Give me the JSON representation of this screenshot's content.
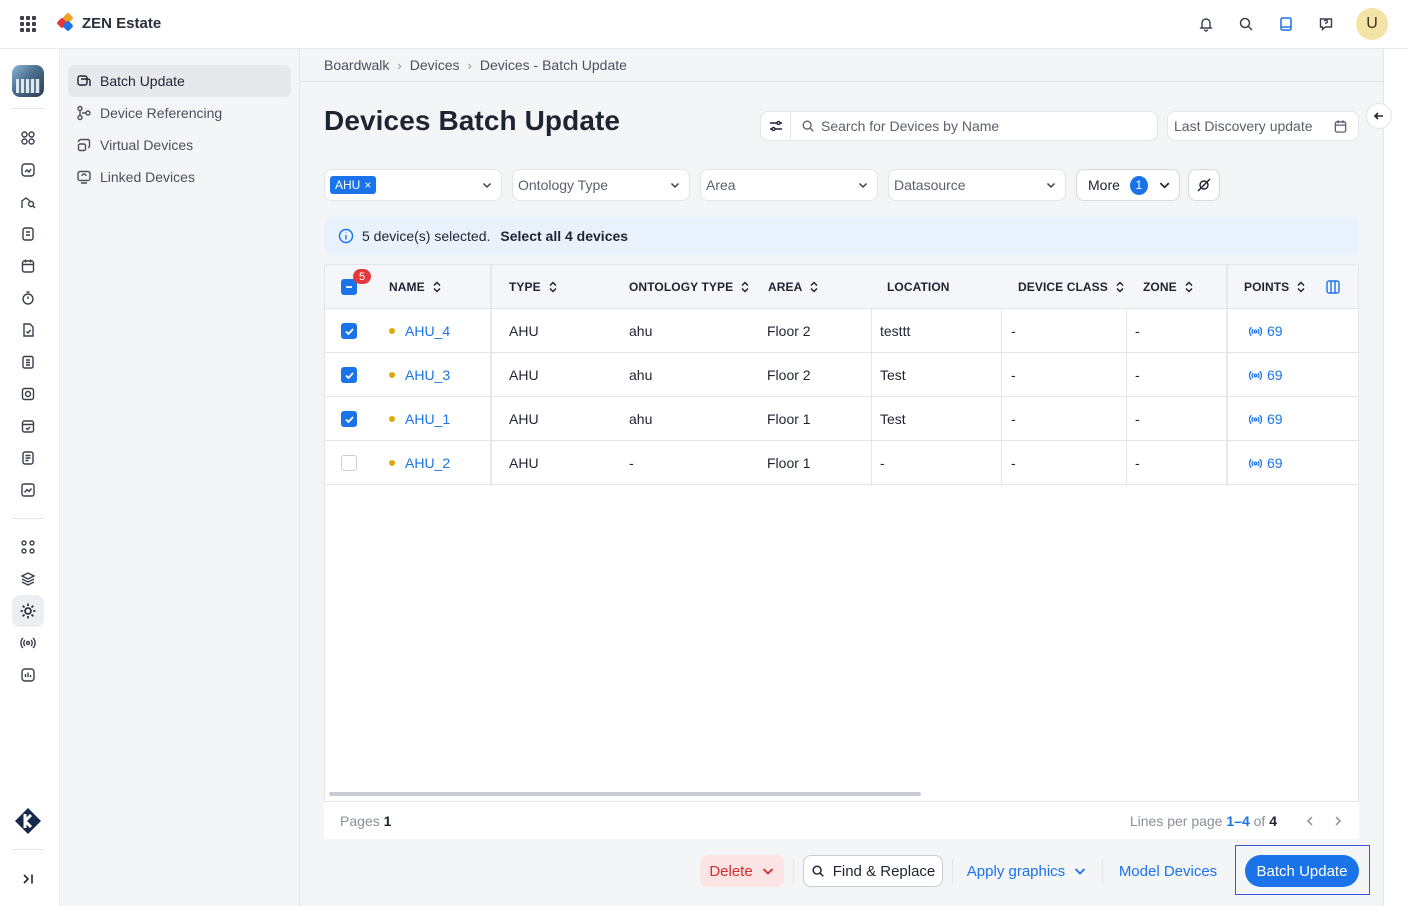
{
  "app": {
    "title": "ZEN Estate",
    "avatar_letter": "U"
  },
  "subnav": {
    "items": [
      {
        "label": "Batch Update",
        "icon": "batch-update-icon",
        "active": true
      },
      {
        "label": "Device Referencing",
        "icon": "device-referencing-icon",
        "active": false
      },
      {
        "label": "Virtual Devices",
        "icon": "virtual-devices-icon",
        "active": false
      },
      {
        "label": "Linked Devices",
        "icon": "linked-devices-icon",
        "active": false
      }
    ]
  },
  "breadcrumb": [
    "Boardwalk",
    "Devices",
    "Devices - Batch Update"
  ],
  "page": {
    "title": "Devices Batch Update"
  },
  "search": {
    "placeholder": "Search for Devices by Name",
    "value": ""
  },
  "date_filter": {
    "label": "Last Discovery update"
  },
  "filters": {
    "type_chip": "AHU",
    "ontology_placeholder": "Ontology Type",
    "area_placeholder": "Area",
    "datasource_placeholder": "Datasource",
    "more_label": "More",
    "more_count": "1"
  },
  "selection": {
    "message": "5 device(s) selected.",
    "select_all": "Select all 4 devices",
    "badge": "5"
  },
  "table": {
    "headers": {
      "name": "NAME",
      "type": "TYPE",
      "ontology": "ONTOLOGY TYPE",
      "area": "AREA",
      "location": "LOCATION",
      "device_class": "DEVICE CLASS",
      "zone": "ZONE",
      "points": "POINTS"
    },
    "rows": [
      {
        "checked": true,
        "name": "AHU_4",
        "type": "AHU",
        "ontology": "ahu",
        "area": "Floor 2",
        "location": "testtt",
        "device_class": "-",
        "zone": "-",
        "points": "69"
      },
      {
        "checked": true,
        "name": "AHU_3",
        "type": "AHU",
        "ontology": "ahu",
        "area": "Floor 2",
        "location": "Test",
        "device_class": "-",
        "zone": "-",
        "points": "69"
      },
      {
        "checked": true,
        "name": "AHU_1",
        "type": "AHU",
        "ontology": "ahu",
        "area": "Floor 1",
        "location": "Test",
        "device_class": "-",
        "zone": "-",
        "points": "69"
      },
      {
        "checked": false,
        "name": "AHU_2",
        "type": "AHU",
        "ontology": "-",
        "area": "Floor 1",
        "location": "-",
        "device_class": "-",
        "zone": "-",
        "points": "69"
      }
    ]
  },
  "pager": {
    "pages_label": "Pages",
    "pages": "1",
    "lines_label": "Lines per page",
    "range": "1–4",
    "of_label": "of",
    "total": "4"
  },
  "actions": {
    "delete": "Delete",
    "find_replace": "Find & Replace",
    "apply_graphics": "Apply graphics",
    "model_devices": "Model Devices",
    "batch_update": "Batch Update"
  },
  "colors": {
    "accent": "#1a73e8",
    "danger": "#d42c2c",
    "status_dot": "#e0a800"
  }
}
